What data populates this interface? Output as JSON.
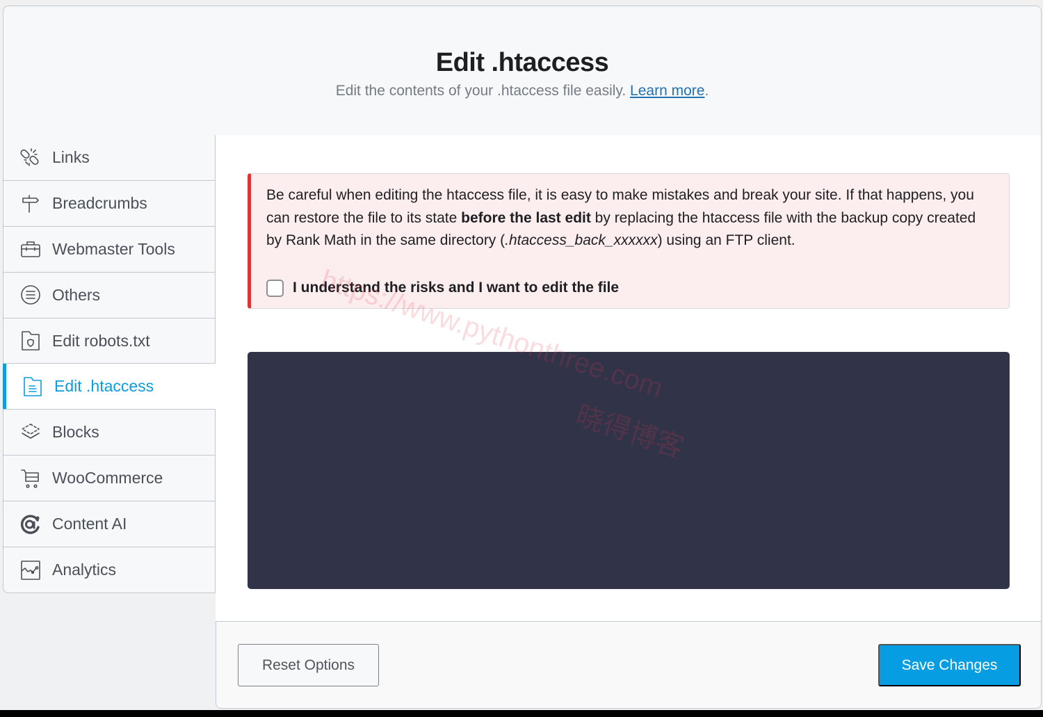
{
  "header": {
    "title": "Edit .htaccess",
    "subtitle": "Edit the contents of your .htaccess file easily.",
    "learn_more": "Learn more",
    "subtitle_end": "."
  },
  "sidebar": {
    "active_item": "Edit .htaccess",
    "items": [
      {
        "label": "Links",
        "icon": "broken-link-icon"
      },
      {
        "label": "Breadcrumbs",
        "icon": "signpost-icon"
      },
      {
        "label": "Webmaster Tools",
        "icon": "toolbox-icon"
      },
      {
        "label": "Others",
        "icon": "list-circle-icon"
      },
      {
        "label": "Edit robots.txt",
        "icon": "folder-shield-icon"
      },
      {
        "label": "Edit .htaccess",
        "icon": "document-folder-icon"
      },
      {
        "label": "Blocks",
        "icon": "layers-icon"
      },
      {
        "label": "WooCommerce",
        "icon": "cart-icon"
      },
      {
        "label": "Content AI",
        "icon": "content-ai-icon"
      },
      {
        "label": "Analytics",
        "icon": "analytics-chart-icon"
      }
    ]
  },
  "warning": {
    "text_part1": "Be careful when editing the htaccess file, it is easy to make mistakes and break your site. If that happens, you can restore the file to its state ",
    "text_bold": "before the last edit",
    "text_part2": " by replacing the htaccess file with the backup copy created by Rank Math in the same directory (",
    "text_italic": ".htaccess_back_xxxxxx",
    "text_part3": ") using an FTP client.",
    "checkbox_label": "I understand the risks and I want to edit the file",
    "checkbox_checked": false
  },
  "editor": {
    "content": ""
  },
  "footer": {
    "reset_label": "Reset Options",
    "save_label": "Save Changes"
  },
  "watermark": {
    "url": "https://www.pythonthree.com",
    "cn": "晓得博客"
  },
  "colors": {
    "accent": "#0b9ddd",
    "save_button": "#069de3",
    "warning_border": "#d63638",
    "warning_bg": "#fcedee",
    "editor_bg": "#313348",
    "link": "#2271b1"
  }
}
